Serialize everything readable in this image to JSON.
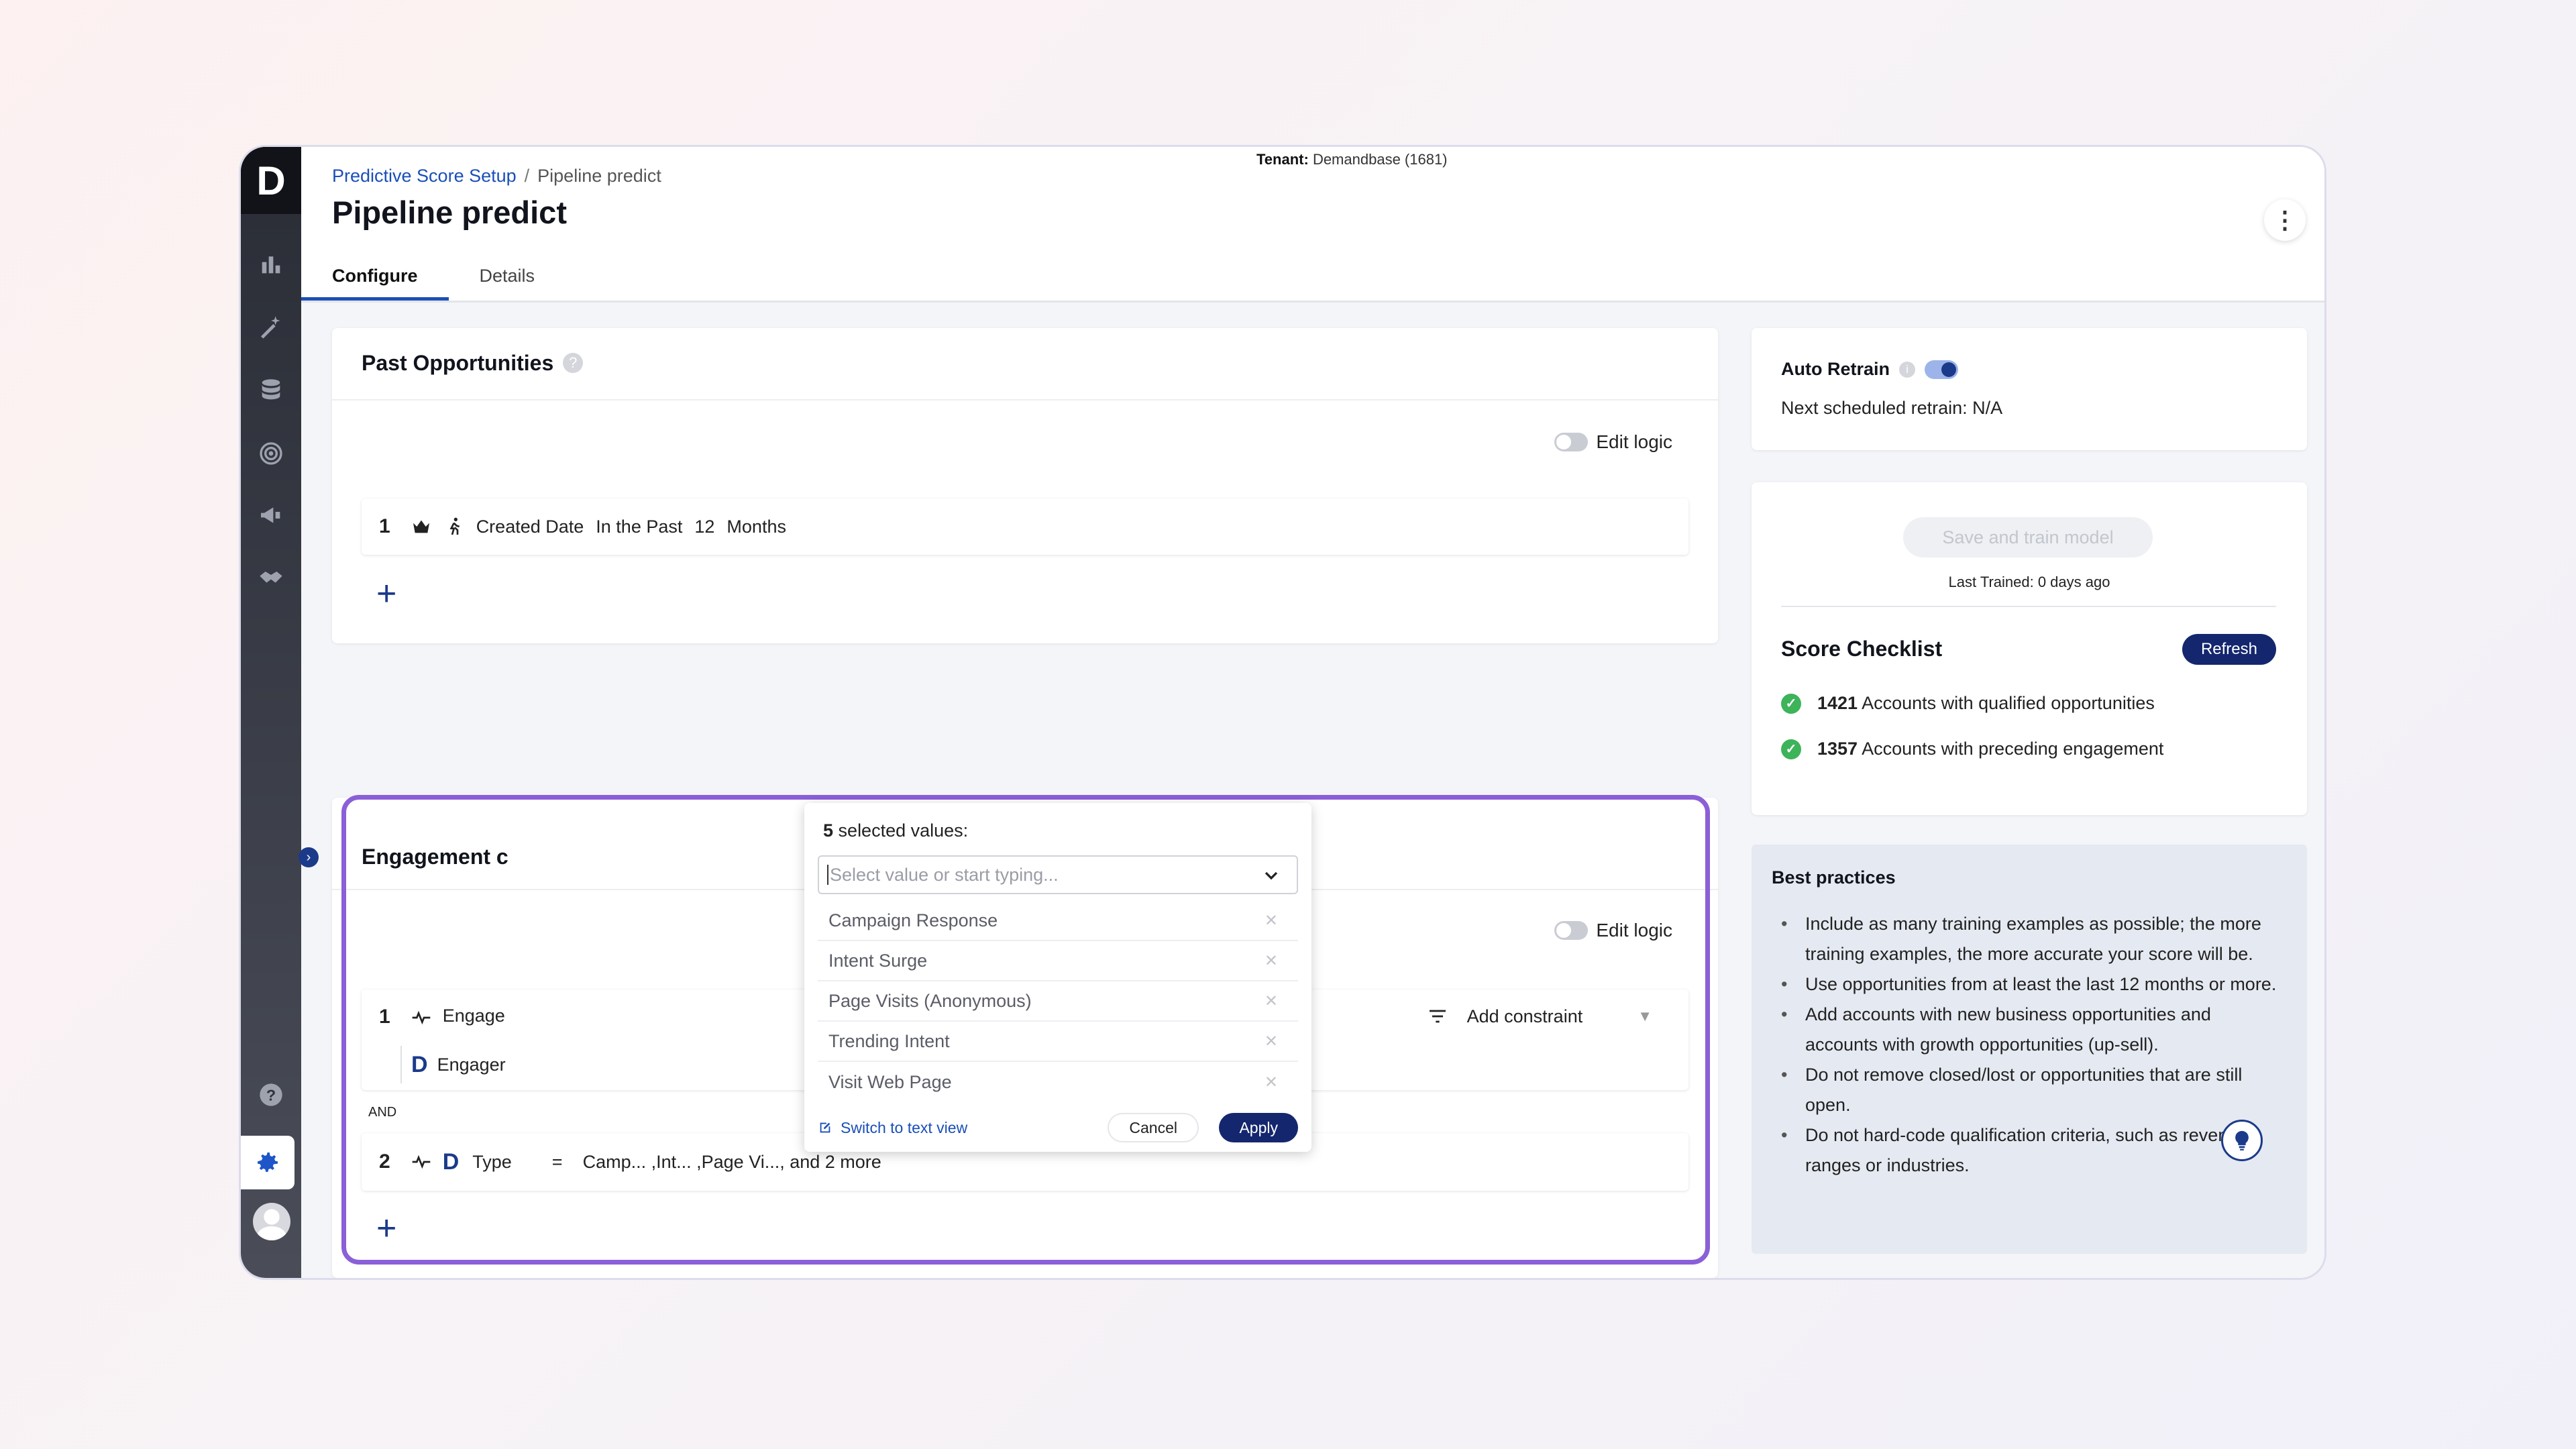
{
  "tenant": {
    "label": "Tenant:",
    "value": "Demandbase (1681)"
  },
  "breadcrumb": {
    "parent": "Predictive Score Setup",
    "separator": "/",
    "current": "Pipeline predict"
  },
  "page_title": "Pipeline predict",
  "tabs": [
    {
      "label": "Configure",
      "active": true
    },
    {
      "label": "Details",
      "active": false
    }
  ],
  "past_opportunities": {
    "title": "Past Opportunities",
    "edit_logic_label": "Edit logic",
    "row1": {
      "num": "1",
      "field": "Created Date",
      "operator": "In the Past",
      "value": "12",
      "unit": "Months"
    }
  },
  "engagement": {
    "title_fragment": "Engagement c",
    "edit_logic_label": "Edit logic",
    "row1": {
      "num": "1",
      "label": "Engage",
      "sub_label": "Engager",
      "add_constraint": "Add constraint"
    },
    "and_label": "AND",
    "row2": {
      "num": "2",
      "field": "Type",
      "operator": "=",
      "value": "Camp... ,Int... ,Page Vi..., and 2 more"
    }
  },
  "dropdown": {
    "count": "5",
    "count_label": "selected values:",
    "placeholder": "Select value or start typing...",
    "items": [
      "Campaign Response",
      "Intent Surge",
      "Page Visits (Anonymous)",
      "Trending Intent",
      "Visit Web Page"
    ],
    "switch_link": "Switch to text view",
    "cancel": "Cancel",
    "apply": "Apply"
  },
  "auto_retrain": {
    "label": "Auto Retrain",
    "next_label": "Next scheduled retrain:",
    "next_value": "N/A",
    "enabled": true
  },
  "train": {
    "button": "Save and train model",
    "last_trained": "Last Trained: 0 days ago"
  },
  "checklist": {
    "title": "Score Checklist",
    "refresh": "Refresh",
    "items": [
      {
        "count": "1421",
        "text": "Accounts with qualified opportunities"
      },
      {
        "count": "1357",
        "text": "Accounts with preceding engagement"
      }
    ]
  },
  "best_practices": {
    "title": "Best practices",
    "items": [
      "Include as many training examples as possible; the more training examples, the more accurate your score will be.",
      "Use opportunities from at least the last 12 months or more.",
      "Add accounts with new business opportunities and accounts with growth opportunities (up-sell).",
      "Do not remove closed/lost or opportunities that are still open.",
      "Do not hard-code qualification criteria, such as revenue ranges or industries."
    ]
  },
  "colors": {
    "accent": "#14276e",
    "link": "#1a4fb8",
    "highlight": "#8b5fd8",
    "success": "#3db35a"
  }
}
